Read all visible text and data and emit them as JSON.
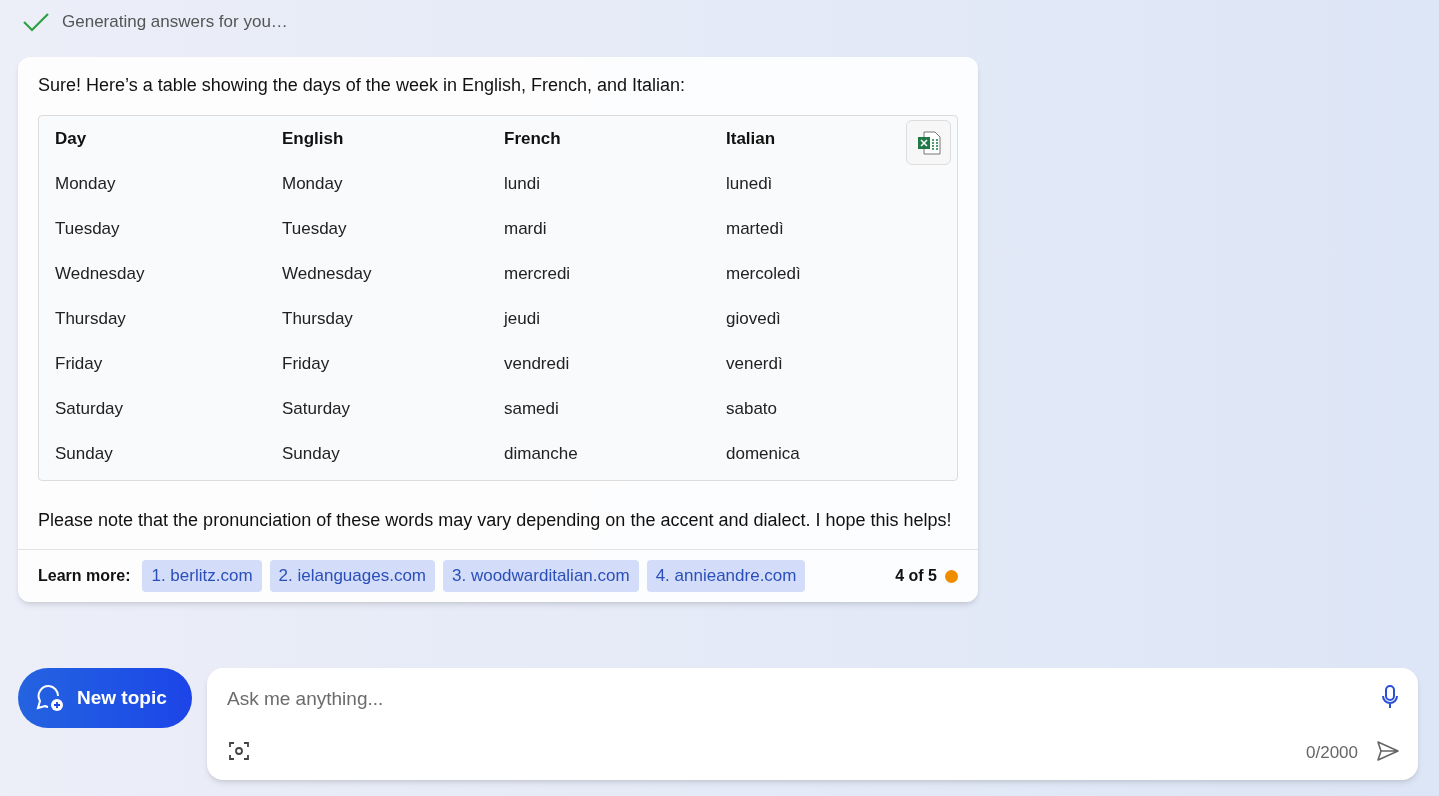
{
  "status": {
    "text": "Generating answers for you…"
  },
  "answer": {
    "intro": "Sure! Here’s a table showing the days of the week in English, French, and Italian:",
    "table": {
      "columns": [
        "Day",
        "English",
        "French",
        "Italian"
      ],
      "rows": [
        [
          "Monday",
          "Monday",
          "lundi",
          "lunedì"
        ],
        [
          "Tuesday",
          "Tuesday",
          "mardi",
          "martedì"
        ],
        [
          "Wednesday",
          "Wednesday",
          "mercredi",
          "mercoledì"
        ],
        [
          "Thursday",
          "Thursday",
          "jeudi",
          "giovedì"
        ],
        [
          "Friday",
          "Friday",
          "vendredi",
          "venerdì"
        ],
        [
          "Saturday",
          "Saturday",
          "samedi",
          "sabato"
        ],
        [
          "Sunday",
          "Sunday",
          "dimanche",
          "domenica"
        ]
      ]
    },
    "note": "Please note that the pronunciation of these words may vary depending on the accent and dialect. I hope this helps!",
    "learn_more": {
      "label": "Learn more:",
      "links": [
        "1. berlitz.com",
        "2. ielanguages.com",
        "3. woodwarditalian.com",
        "4. annieandre.com"
      ]
    },
    "counter": "4 of 5"
  },
  "new_topic": {
    "label": "New topic"
  },
  "input": {
    "placeholder": "Ask me anything...",
    "count": "0/2000"
  }
}
